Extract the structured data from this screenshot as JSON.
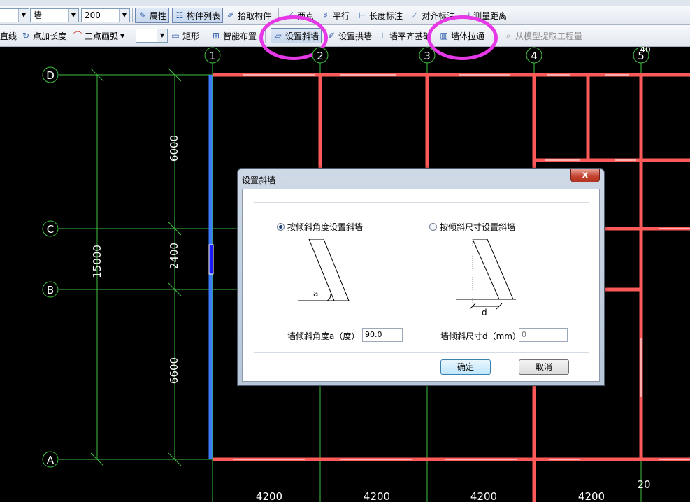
{
  "toolbar1": {
    "type_value": "墙",
    "size_value": "200",
    "properties_label": "属性",
    "component_list_label": "构件列表",
    "pick_component_label": "拾取构件",
    "two_points_label": "两点",
    "parallel_label": "平行",
    "length_annotation_label": "长度标注",
    "align_annotation_label": "对齐标注",
    "measure_distance_label": "测量距离"
  },
  "toolbar2": {
    "line_label": "直线",
    "point_length_label": "点加长度",
    "three_point_arc_label": "三点画弧",
    "rectangle_label": "矩形",
    "smart_layout_label": "智能布置",
    "set_slant_wall_label": "设置斜墙",
    "set_arch_wall_label": "设置拱墙",
    "wall_align_base_label": "墙平齐基础",
    "wall_extend_label": "墙体拉通",
    "extract_quantities_label": "从模型提取工程量"
  },
  "grid": {
    "columns": [
      "1",
      "2",
      "3",
      "4",
      "5"
    ],
    "rows": [
      "D",
      "C",
      "B",
      "A"
    ],
    "bottom_spans": [
      "4200",
      "4200",
      "4200",
      "4200"
    ],
    "left_spans": [
      "6000",
      "2400",
      "6600"
    ],
    "total_height": "15000",
    "corner_labels": [
      "40",
      "20"
    ]
  },
  "dialog": {
    "title": "设置斜墙",
    "close_glyph": "x",
    "option_angle": "按倾斜角度设置斜墙",
    "option_size": "按倾斜尺寸设置斜墙",
    "diagram_angle_letter": "a",
    "diagram_size_letter": "d",
    "angle_field_label": "墙倾斜角度a（度）",
    "angle_value": "90.0",
    "size_field_label": "墙倾斜尺寸d（mm）",
    "size_value": "0",
    "ok_label": "确定",
    "cancel_label": "取消"
  },
  "colors": {
    "wall": "#ff5a5a",
    "grid_line": "#3fbf3f",
    "highlight": "#e638e6",
    "selected_wall": "#3a7bff"
  }
}
